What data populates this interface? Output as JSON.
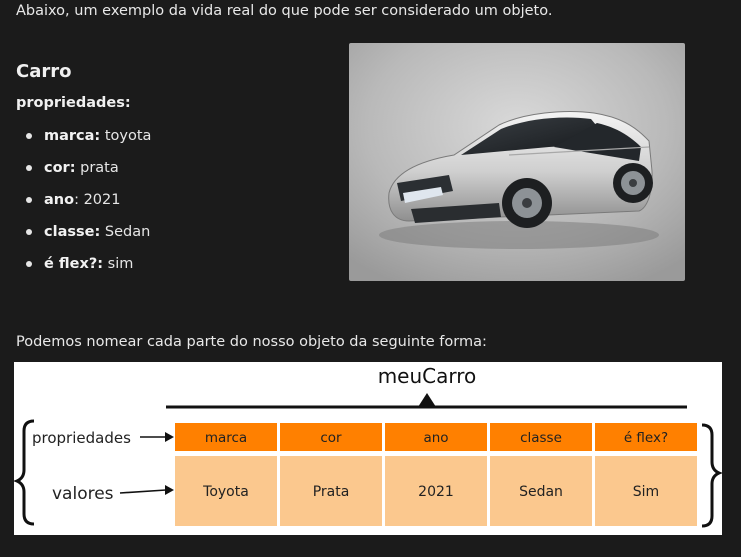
{
  "intro_text": "Abaixo, um exemplo da vida real do que pode ser considerado um objeto.",
  "car_title": "Carro",
  "properties_title": "propriedades:",
  "properties": [
    {
      "key": "marca:",
      "value": " toyota"
    },
    {
      "key": "cor:",
      "value": " prata"
    },
    {
      "key": "ano",
      "value": ": 2021"
    },
    {
      "key": "classe:",
      "value": " Sedan"
    },
    {
      "key": "é flex?:",
      "value": " sim"
    }
  ],
  "car_image_alt": "car-photo",
  "section_text": "Podemos nomear cada parte do nosso objeto da seguinte forma:",
  "diagram": {
    "object_name": "meuCarro",
    "row_label_properties": "propriedades",
    "row_label_values": "valores",
    "headers": [
      "marca",
      "cor",
      "ano",
      "classe",
      "é flex?"
    ],
    "values": [
      "Toyota",
      "Prata",
      "2021",
      "Sedan",
      "Sim"
    ],
    "header_color": "#ff8000",
    "value_color": "#fbc88e"
  }
}
